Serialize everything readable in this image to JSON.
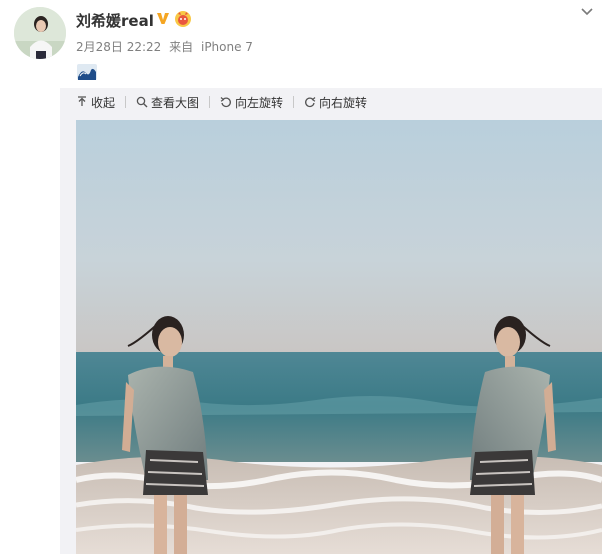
{
  "post": {
    "username": "刘希媛real",
    "date": "2月28日 22:22",
    "source_prefix": "来自",
    "device": "iPhone 7"
  },
  "icons": {
    "verified": "verified-v-icon",
    "badge": "member-badge-icon",
    "emoji": "wave-emoji-icon",
    "menu": "chevron-down-icon"
  },
  "toolbar": {
    "collapse": "收起",
    "view_large": "查看大图",
    "rotate_left": "向左旋转",
    "rotate_right": "向右旋转"
  },
  "colors": {
    "verified": "#f5a623",
    "badge": "#e9573f",
    "sky": "#b8cbd8",
    "sea": "#3f7f8d"
  }
}
